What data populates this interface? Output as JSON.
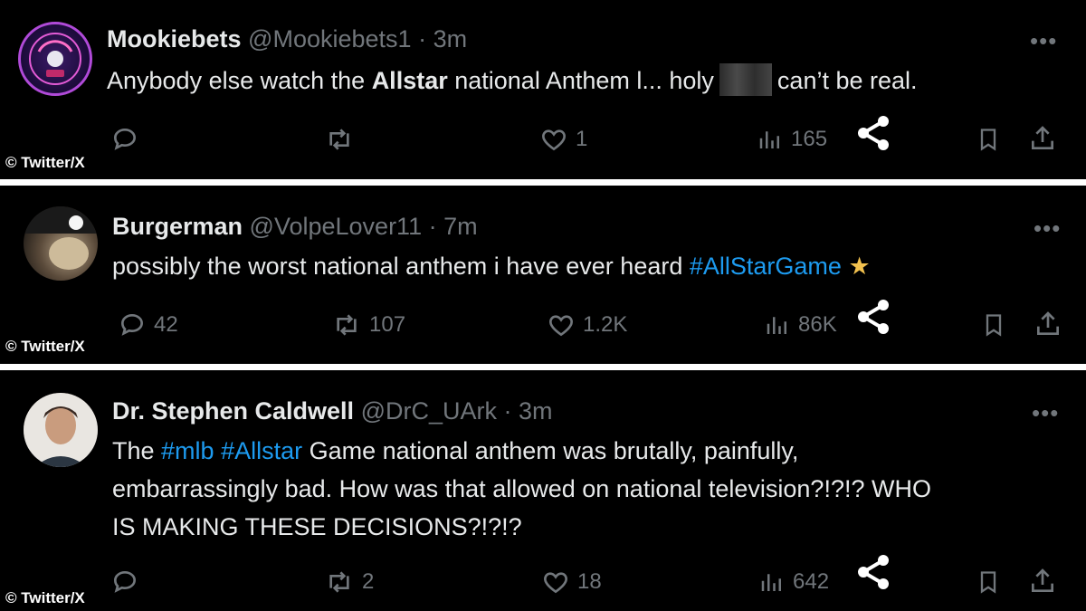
{
  "credit": "© Twitter/X",
  "tweets": [
    {
      "name": "Mookiebets",
      "handle": "@Mookiebets1",
      "time": "3m",
      "text_a": "Anybody else watch the ",
      "text_bold": "Allstar",
      "text_b": " national Anthem l... holy",
      "text_c": "can’t be real.",
      "replies": "",
      "retweets": "",
      "likes": "1",
      "views": "165"
    },
    {
      "name": "Burgerman",
      "handle": "@VolpeLover11",
      "time": "7m",
      "text_a": "possibly the worst national anthem i have ever heard ",
      "hashtag": "#AllStarGame",
      "star": "★",
      "replies": "42",
      "retweets": "107",
      "likes": "1.2K",
      "views": "86K"
    },
    {
      "name": "Dr. Stephen Caldwell",
      "handle": "@DrC_UArk",
      "time": "3m",
      "text_a": "The ",
      "hashtag1": "#mlb",
      "hashtag2": "#Allstar",
      "text_line1_rest": " Game national anthem was brutally, painfully,",
      "text_line2": "embarrassingly bad. How was that allowed on national television?!?!? WHO",
      "text_line3": "IS MAKING THESE DECISIONS?!?!?",
      "replies": "",
      "retweets": "2",
      "likes": "18",
      "views": "642"
    }
  ],
  "icons": {
    "reply": "reply-icon",
    "retweet": "retweet-icon",
    "like": "heart-icon",
    "views": "views-icon",
    "share": "share-icon",
    "bookmark": "bookmark-icon",
    "more": "more-icon"
  },
  "colors": {
    "background": "#000000",
    "text": "#e7e9ea",
    "muted": "#71767b",
    "link": "#1d9bf0"
  }
}
